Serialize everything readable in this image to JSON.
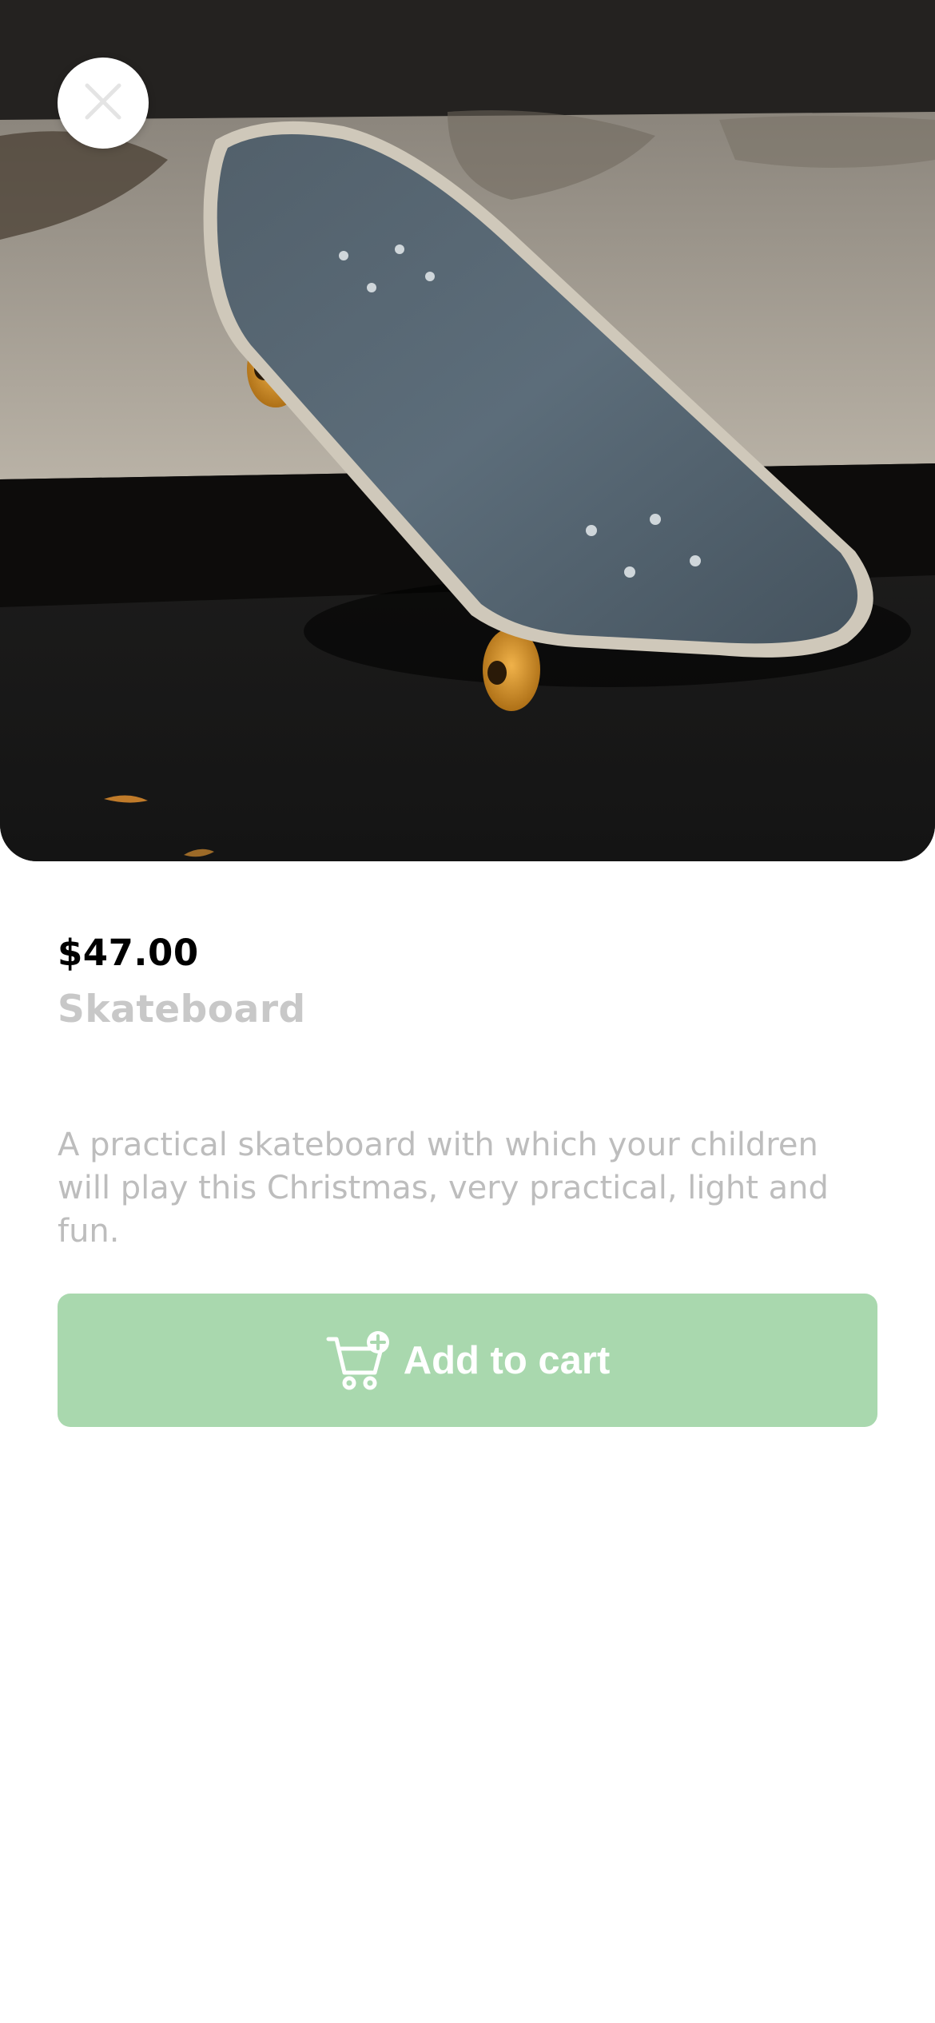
{
  "product": {
    "image": "skateboard-photo",
    "price": "$47.00",
    "name": "Skateboard",
    "description": "A practical skateboard with which your children will play this Christmas, very practical, light and fun."
  },
  "actions": {
    "close_icon": "close-icon",
    "add_to_cart_label": "Add to cart",
    "add_to_cart_icon": "cart-plus-icon"
  },
  "colors": {
    "primary_button": "#a9d8ae",
    "price_text": "#000000",
    "name_text": "#c8c8c8",
    "description_text": "#bdbdbd"
  }
}
